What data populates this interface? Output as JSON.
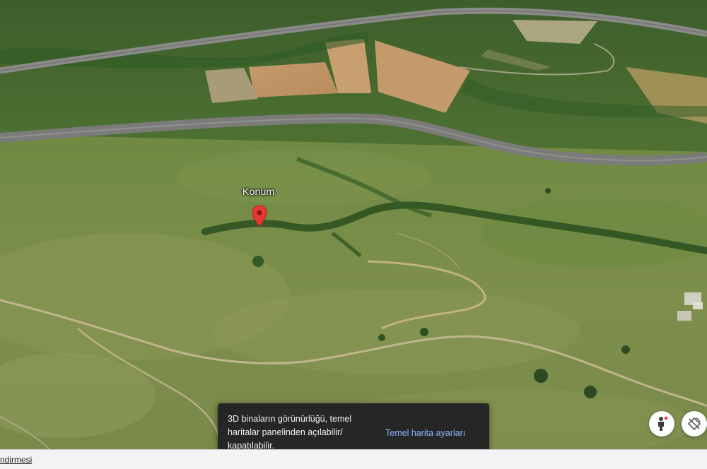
{
  "map": {
    "view": "satellite-3d",
    "place_label": "Konum",
    "marker_icon": "map-pin-icon",
    "marker_color": "#e53935"
  },
  "toast": {
    "message": "3D binaların görünürlüğü, temel haritalar panelinden açılabilir/ kapatılabilir.",
    "action_label": "Temel harita ayarları",
    "action_color": "#8ab4f8"
  },
  "controls": {
    "pegman_icon": "pegman-icon",
    "rotate_icon": "tilt-rotate-icon"
  },
  "footer": {
    "link_text": "ndirmesi"
  }
}
